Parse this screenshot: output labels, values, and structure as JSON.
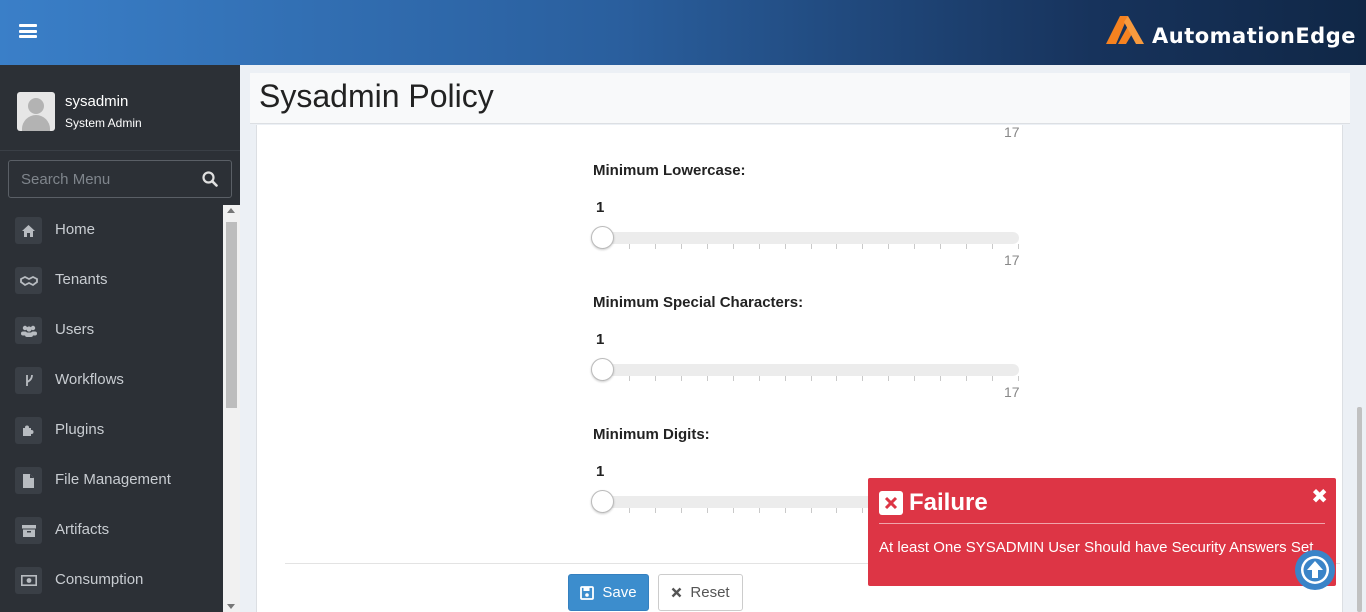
{
  "header": {
    "brand_text": "AutomationEdge",
    "accent_color": "#f58220"
  },
  "user": {
    "name": "sysadmin",
    "role": "System Admin"
  },
  "search": {
    "placeholder": "Search Menu"
  },
  "sidebar": {
    "items": [
      {
        "label": "Home",
        "icon": "home-icon"
      },
      {
        "label": "Tenants",
        "icon": "handshake-icon"
      },
      {
        "label": "Users",
        "icon": "users-icon"
      },
      {
        "label": "Workflows",
        "icon": "workflow-icon"
      },
      {
        "label": "Plugins",
        "icon": "puzzle-icon"
      },
      {
        "label": "File Management",
        "icon": "file-icon"
      },
      {
        "label": "Artifacts",
        "icon": "archive-icon"
      },
      {
        "label": "Consumption",
        "icon": "money-icon"
      }
    ]
  },
  "page": {
    "title": "Sysadmin Policy",
    "top_slider_max": "17"
  },
  "sliders": [
    {
      "label": "Minimum Lowercase:",
      "value": "1",
      "max": "17"
    },
    {
      "label": "Minimum Special Characters:",
      "value": "1",
      "max": "17"
    },
    {
      "label": "Minimum Digits:",
      "value": "1",
      "max": "17"
    }
  ],
  "actions": {
    "save_label": "Save",
    "reset_label": "Reset"
  },
  "toast": {
    "title": "Failure",
    "message": "At least One SYSADMIN User Should have Security Answers Set",
    "color": "#dd3545"
  }
}
